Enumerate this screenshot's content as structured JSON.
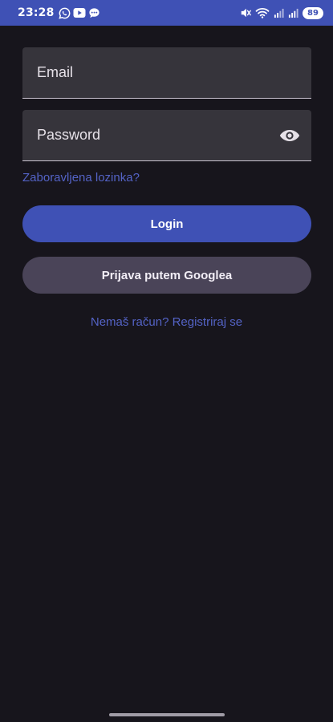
{
  "status_bar": {
    "time": "23:28",
    "left_icons": [
      "whatsapp-icon",
      "youtube-icon",
      "chat-bubble-icon"
    ],
    "right_icons": [
      "mute-icon",
      "wifi-icon",
      "signal-icon",
      "signal-icon"
    ],
    "battery_level": "89",
    "background_color": "#3f51b5"
  },
  "login_form": {
    "email_placeholder": "Email",
    "password_placeholder": "Password",
    "password_visibility_icon": "eye-icon",
    "forgot_password_label": "Zaboravljena lozinka?",
    "login_button_label": "Login",
    "google_button_label": "Prijava putem Googlea",
    "register_prompt": "Nemaš račun? Registriraj se"
  },
  "colors": {
    "background": "#17151c",
    "field_background": "#36343b",
    "primary": "#3f51b5",
    "link": "#5463c6",
    "secondary_button": "#4a4458"
  }
}
